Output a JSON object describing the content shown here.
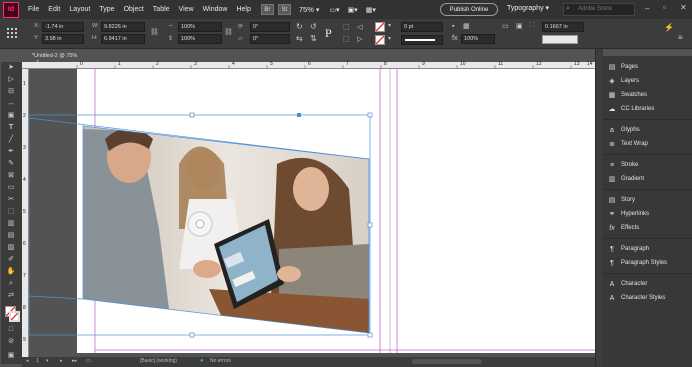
{
  "app": {
    "logo": "Id",
    "zoom": "75%"
  },
  "menu": [
    "File",
    "Edit",
    "Layout",
    "Type",
    "Object",
    "Table",
    "View",
    "Window",
    "Help"
  ],
  "menubar_buttons": {
    "br": "Br",
    "st": "St"
  },
  "publish_label": "Publish Online",
  "workspace_label": "Typography",
  "search_placeholder": "Adobe Stock",
  "control": {
    "x_label": "X:",
    "x_value": "-1.74 in",
    "y_label": "Y:",
    "y_value": "3.98 in",
    "w_label": "W:",
    "w_value": "9.8226 in",
    "h_label": "H:",
    "h_value": "6.9417 in",
    "scale_x": "100%",
    "scale_y": "100%",
    "rotate": "0°",
    "shear": "0°",
    "stroke_weight": "0 pt",
    "opacity": "100%",
    "ref_value": "0.1667 in"
  },
  "doc_tab": "*Untitled-2 @ 75%",
  "ruler_h": [
    "0",
    "1",
    "2",
    "3",
    "4",
    "5",
    "6",
    "7",
    "8",
    "9",
    "10",
    "11",
    "12",
    "13",
    "14"
  ],
  "ruler_v": [
    "1",
    "2",
    "3",
    "4",
    "5",
    "6",
    "7",
    "8",
    "9"
  ],
  "status": {
    "page": "1",
    "style": "[Basic] (working)",
    "errors": "No errors"
  },
  "panels": [
    {
      "icon": "pages-icon",
      "glyph": "▤",
      "label": "Pages"
    },
    {
      "icon": "layers-icon",
      "glyph": "◈",
      "label": "Layers"
    },
    {
      "icon": "swatches-icon",
      "glyph": "▦",
      "label": "Swatches"
    },
    {
      "icon": "cc-libraries-icon",
      "glyph": "☁",
      "label": "CC Libraries"
    },
    {
      "icon": "glyphs-icon",
      "glyph": "a",
      "label": "Glyphs"
    },
    {
      "icon": "text-wrap-icon",
      "glyph": "≣",
      "label": "Text Wrap"
    },
    {
      "icon": "stroke-icon",
      "glyph": "≡",
      "label": "Stroke"
    },
    {
      "icon": "gradient-icon",
      "glyph": "▥",
      "label": "Gradient"
    },
    {
      "icon": "story-icon",
      "glyph": "▤",
      "label": "Story"
    },
    {
      "icon": "hyperlinks-icon",
      "glyph": "⚭",
      "label": "Hyperlinks"
    },
    {
      "icon": "effects-icon",
      "glyph": "fx",
      "label": "Effects"
    },
    {
      "icon": "paragraph-icon",
      "glyph": "¶",
      "label": "Paragraph"
    },
    {
      "icon": "paragraph-styles-icon",
      "glyph": "¶",
      "label": "Paragraph Styles"
    },
    {
      "icon": "character-icon",
      "glyph": "A",
      "label": "Character"
    },
    {
      "icon": "character-styles-icon",
      "glyph": "A",
      "label": "Character Styles"
    }
  ],
  "colors": {
    "menubar": "#323232",
    "panel": "#383838",
    "accent": "#ff3366",
    "selection": "#4a90d9",
    "guide": "#cc66cc"
  }
}
